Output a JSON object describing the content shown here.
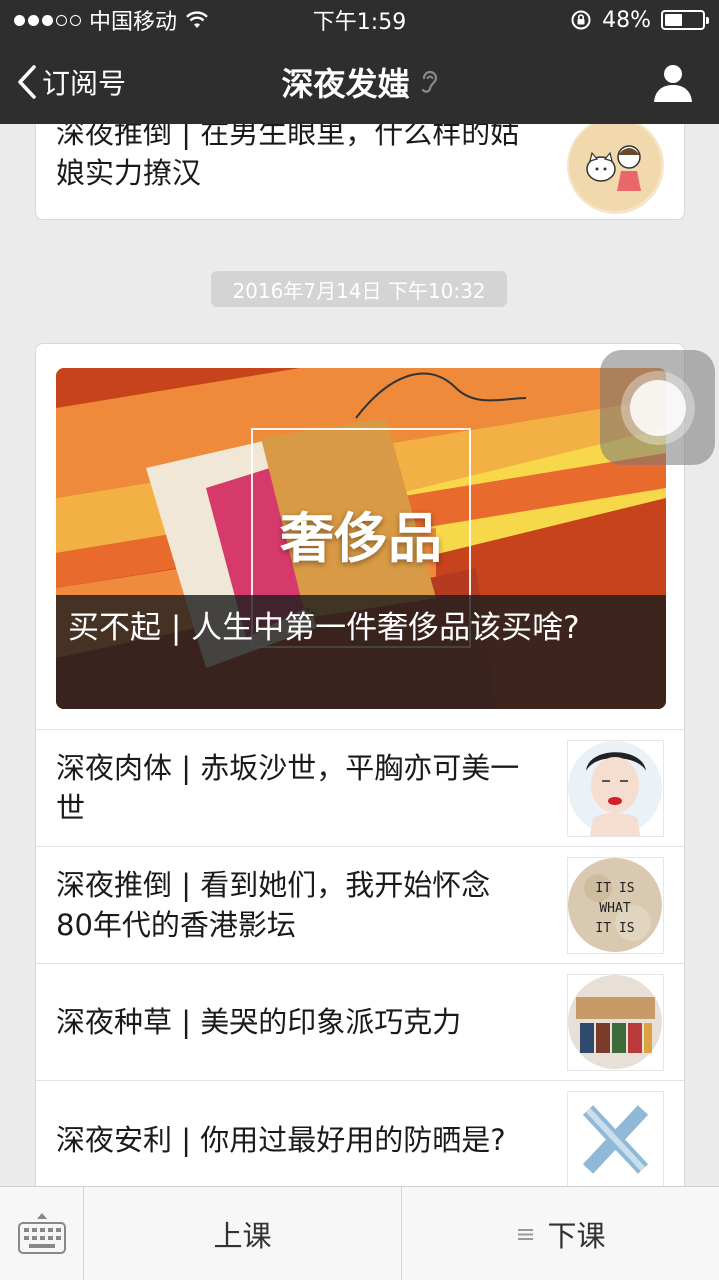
{
  "status_bar": {
    "carrier": "中国移动",
    "time": "下午1:59",
    "battery": "48%",
    "battery_level": 0.48
  },
  "nav": {
    "back_label": "订阅号",
    "title": "深夜发媸"
  },
  "previous_article": {
    "title": "深夜推倒 | 在男生眼里，什么样的姑娘实力撩汉"
  },
  "timestamp": "2016年7月14日 下午10:32",
  "main_article": {
    "hero_text": "奢侈品",
    "hero_title": "买不起 | 人生中第一件奢侈品该买啥?"
  },
  "sub_articles": [
    {
      "title": "深夜肉体 | 赤坂沙世，平胸亦可美一世",
      "thumb": "portrait-thumb"
    },
    {
      "title": "深夜推倒 | 看到她们，我开始怀念80年代的香港影坛",
      "thumb": "it-is-what-it-is-thumb",
      "thumb_text": "IT IS WHAT IT IS"
    },
    {
      "title": "深夜种草 | 美哭的印象派巧克力",
      "thumb": "chocolate-thumb"
    },
    {
      "title": "深夜安利 | 你用过最好用的防晒是?",
      "thumb": "x-thumb"
    }
  ],
  "toolbar": {
    "menu_left": "上课",
    "menu_right": "下课"
  },
  "colors": {
    "nav_bg": "#2e2e2f",
    "page_bg": "#ebebeb",
    "hero_orange": "#e46a25"
  }
}
